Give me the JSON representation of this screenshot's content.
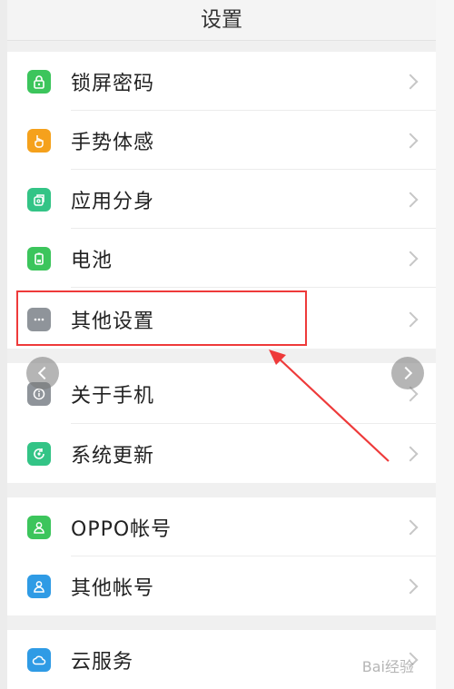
{
  "header": {
    "title": "设置"
  },
  "rows": [
    {
      "label": "锁屏密码",
      "icon": "lock-icon",
      "color": "#3cc55c"
    },
    {
      "label": "手势体感",
      "icon": "gesture-hand-icon",
      "color": "#f5a11c"
    },
    {
      "label": "应用分身",
      "icon": "app-clone-icon",
      "color": "#33c486"
    },
    {
      "label": "电池",
      "icon": "battery-icon",
      "color": "#3cc55c"
    },
    {
      "label": "其他设置",
      "icon": "more-dots-icon",
      "color": "#8f949a"
    },
    {
      "label": "关于手机",
      "icon": "info-icon",
      "color": "#8f949a"
    },
    {
      "label": "系统更新",
      "icon": "update-icon",
      "color": "#33c486"
    },
    {
      "label": "OPPO帐号",
      "icon": "account-person-icon",
      "color": "#3cc55c"
    },
    {
      "label": "其他帐号",
      "icon": "account-person-icon",
      "color": "#2f9be5"
    },
    {
      "label": "云服务",
      "icon": "cloud-icon",
      "color": "#2f9be5"
    }
  ],
  "annotation": {
    "highlight_color": "#ee3a3a"
  },
  "watermark": "Bai经验"
}
